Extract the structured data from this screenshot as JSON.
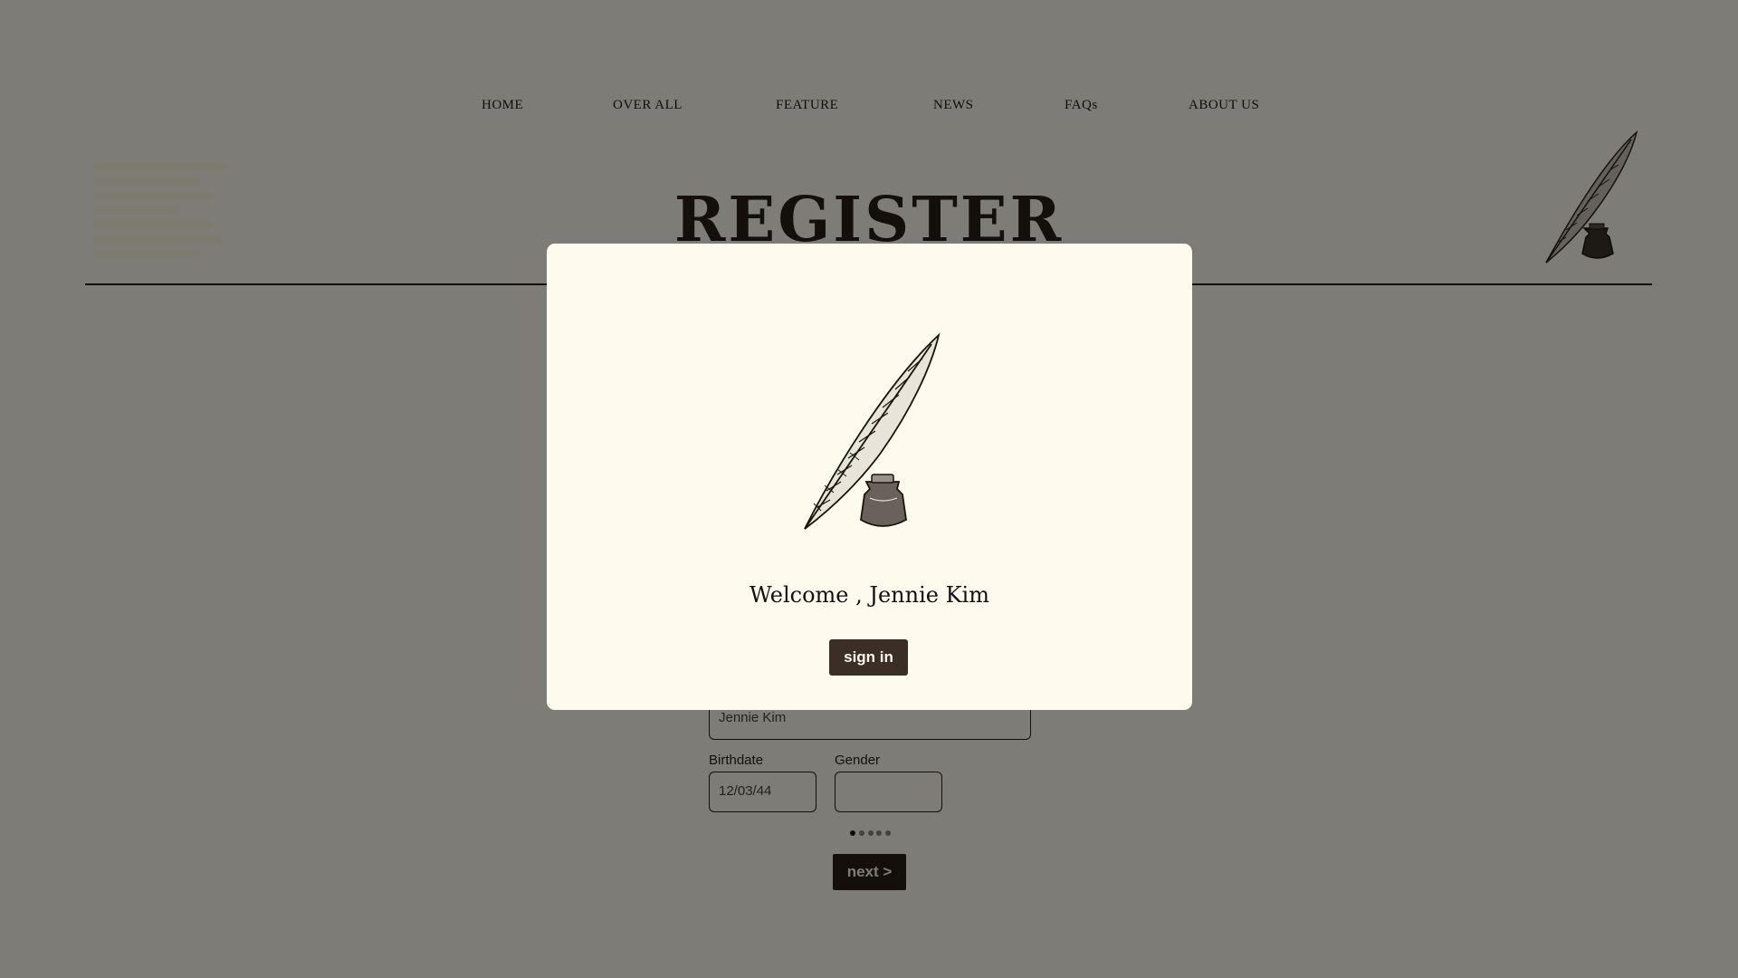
{
  "nav": {
    "items": [
      {
        "label": "HOME"
      },
      {
        "label": "OVER ALL"
      },
      {
        "label": "FEATURE"
      },
      {
        "label": "NEWS"
      },
      {
        "label": "FAQs"
      },
      {
        "label": "ABOUT US"
      }
    ]
  },
  "header": {
    "title": "REGISTER"
  },
  "form": {
    "name_value": "Jennie Kim",
    "birthdate_label": "Birthdate",
    "birthdate_value": "12/03/44",
    "gender_label": "Gender",
    "gender_value": "",
    "step_current": 1,
    "step_total": 5,
    "next_label": "next >"
  },
  "modal": {
    "welcome_text": "Welcome , Jennie Kim",
    "signin_label": "sign in"
  },
  "colors": {
    "ink": "#2a1f17",
    "paper": "#fdf9ee",
    "overlay": "rgba(0,0,0,0.5)"
  }
}
